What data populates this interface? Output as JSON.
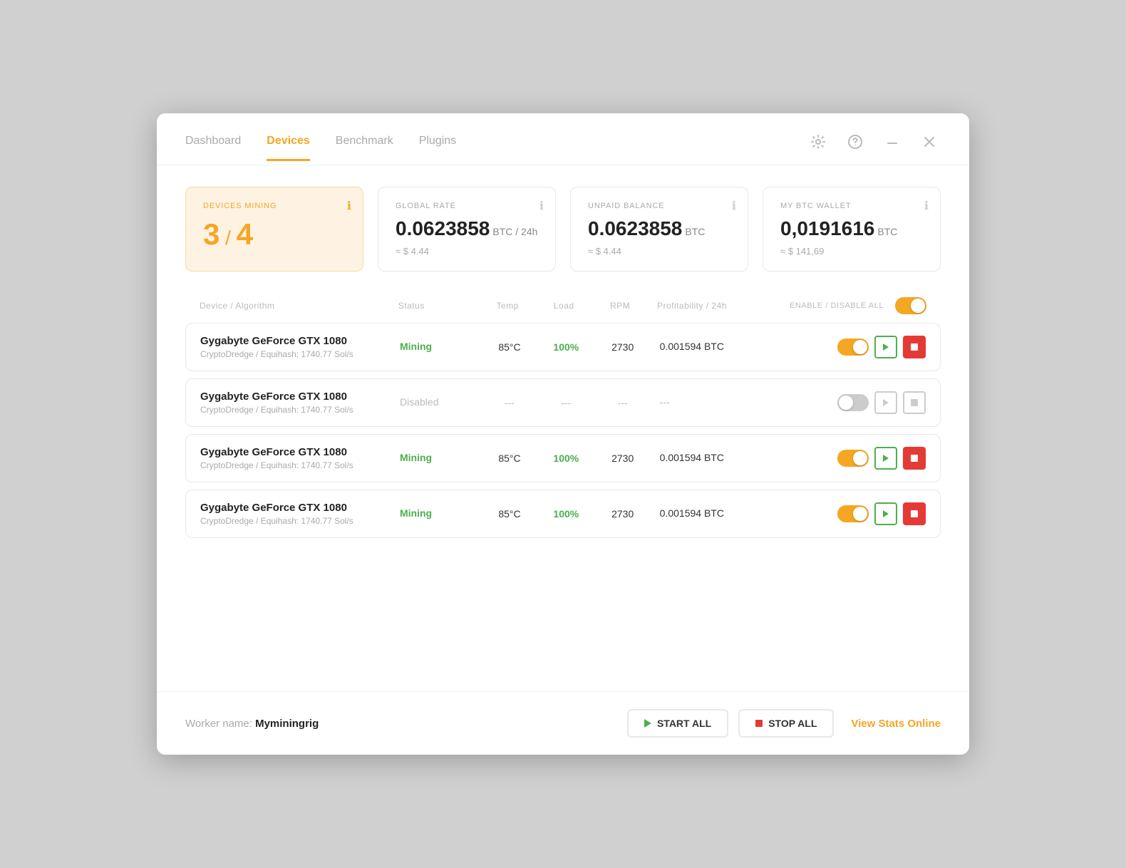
{
  "nav": {
    "tabs": [
      {
        "id": "dashboard",
        "label": "Dashboard",
        "active": false
      },
      {
        "id": "devices",
        "label": "Devices",
        "active": true
      },
      {
        "id": "benchmark",
        "label": "Benchmark",
        "active": false
      },
      {
        "id": "plugins",
        "label": "Plugins",
        "active": false
      }
    ]
  },
  "stats": {
    "devices_mining": {
      "label": "DEVICES MINING",
      "current": "3",
      "total": "4"
    },
    "global_rate": {
      "label": "GLOBAL RATE",
      "value": "0.0623858",
      "unit": "BTC / 24h",
      "subvalue": "≈ $ 4.44"
    },
    "unpaid_balance": {
      "label": "UNPAID BALANCE",
      "value": "0.0623858",
      "unit": "BTC",
      "subvalue": "≈ $ 4.44"
    },
    "btc_wallet": {
      "label": "MY BTC WALLET",
      "value": "0,0191616",
      "unit": "BTC",
      "subvalue": "≈ $ 141,69"
    }
  },
  "table": {
    "columns": {
      "device": "Device / Algorithm",
      "status": "Status",
      "temp": "Temp",
      "load": "Load",
      "rpm": "RPM",
      "profit": "Profitability / 24h",
      "actions": "ENABLE / DISABLE ALL"
    },
    "rows": [
      {
        "name": "Gygabyte GeForce GTX 1080",
        "algo": "CryptoDredge / Equihash: 1740.77 Sol/s",
        "status": "Mining",
        "status_type": "mining",
        "temp": "85°C",
        "load": "100%",
        "rpm": "2730",
        "profit": "0.001594 BTC",
        "enabled": true
      },
      {
        "name": "Gygabyte GeForce GTX 1080",
        "algo": "CryptoDredge / Equihash: 1740.77 Sol/s",
        "status": "Disabled",
        "status_type": "disabled",
        "temp": "---",
        "load": "---",
        "rpm": "---",
        "profit": "---",
        "enabled": false
      },
      {
        "name": "Gygabyte GeForce GTX 1080",
        "algo": "CryptoDredge / Equihash: 1740.77 Sol/s",
        "status": "Mining",
        "status_type": "mining",
        "temp": "85°C",
        "load": "100%",
        "rpm": "2730",
        "profit": "0.001594 BTC",
        "enabled": true
      },
      {
        "name": "Gygabyte GeForce GTX 1080",
        "algo": "CryptoDredge / Equihash: 1740.77 Sol/s",
        "status": "Mining",
        "status_type": "mining",
        "temp": "85°C",
        "load": "100%",
        "rpm": "2730",
        "profit": "0.001594 BTC",
        "enabled": true
      }
    ]
  },
  "footer": {
    "worker_label": "Worker name:",
    "worker_name": "Myminingrig",
    "start_all": "START ALL",
    "stop_all": "STOP ALL",
    "view_stats": "View Stats Online"
  }
}
